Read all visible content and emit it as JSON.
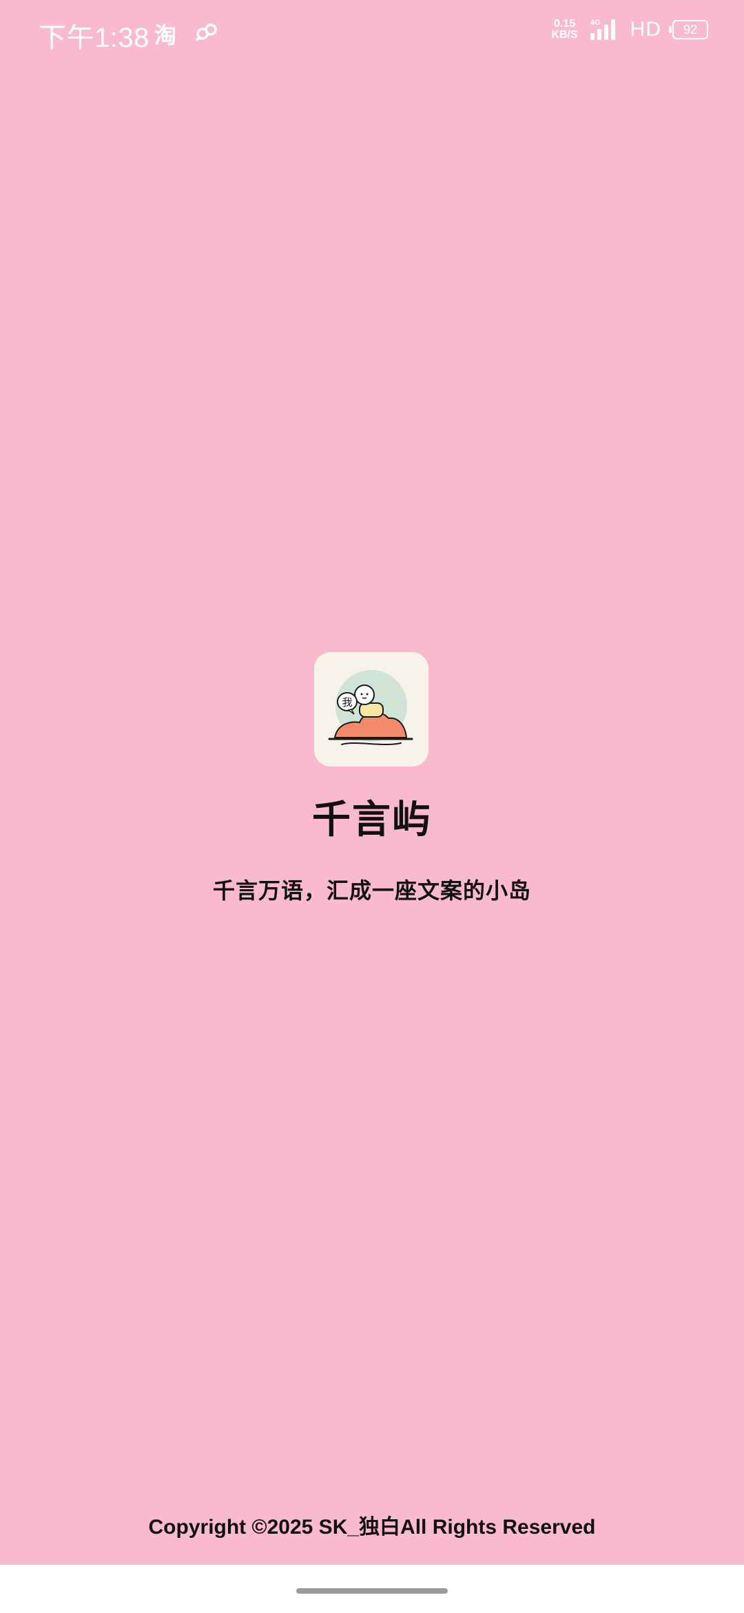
{
  "status_bar": {
    "time": "下午1:38",
    "taobao_icon_label": "淘",
    "net_speed_value": "0.15",
    "net_speed_unit": "KB/S",
    "network_type": "4G",
    "hd_label": "HD",
    "battery_level": "92",
    "icons": [
      "taobao-icon",
      "link-icon",
      "signal-icon",
      "battery-icon"
    ]
  },
  "splash": {
    "app_name": "千言屿",
    "tagline": "千言万语，汇成一座文案的小岛",
    "icon_bubble_text": "我"
  },
  "footer": {
    "copyright": "Copyright ©2025 SK_独白All Rights Reserved"
  },
  "colors": {
    "background": "#f9bace",
    "icon_background": "#f7f2ea",
    "island": "#f28a6b",
    "icon_circle": "#cfe3d6"
  }
}
